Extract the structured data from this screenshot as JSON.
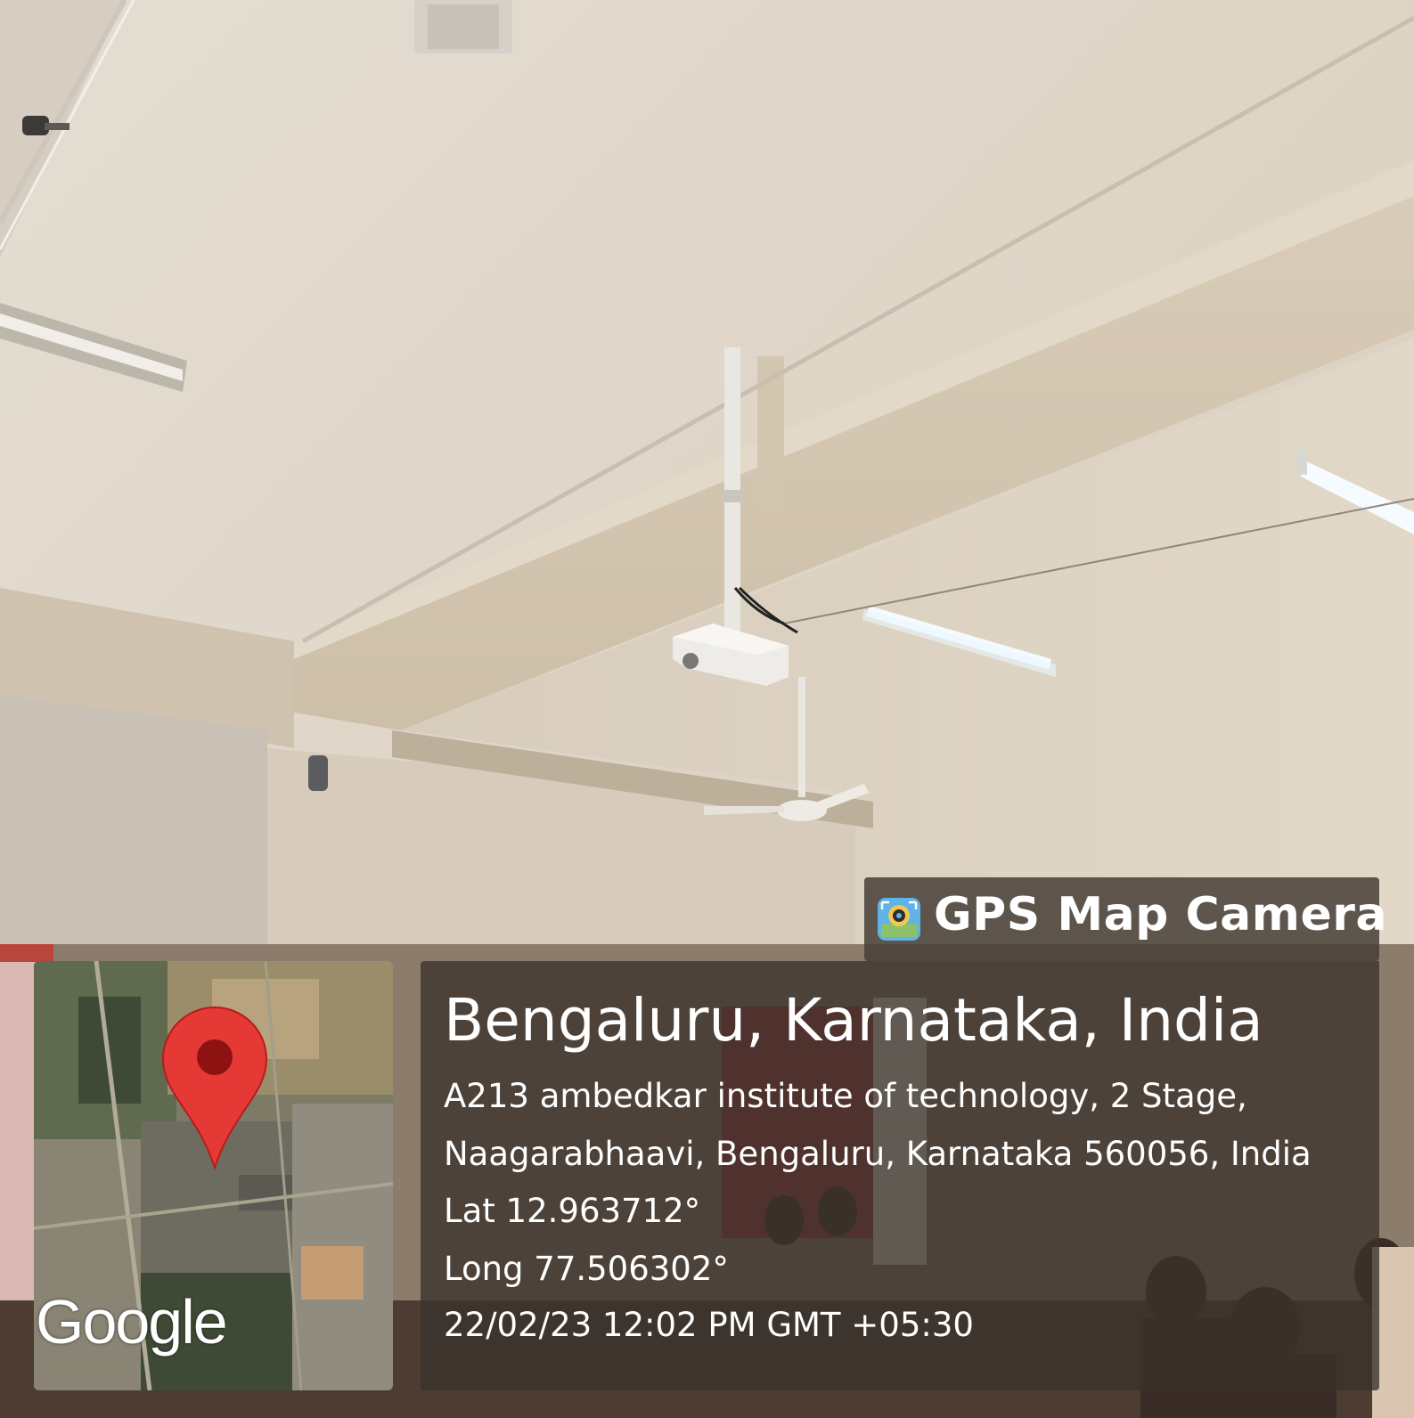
{
  "overlay": {
    "app_title": "GPS Map Camera",
    "app_icon": "gps-map-camera-app-icon",
    "location_title": "Bengaluru, Karnataka, India",
    "address_line1": "A213 ambedkar institute of technology, 2 Stage,",
    "address_line2": "Naagarabhaavi, Bengaluru, Karnataka 560056, India",
    "lat": "Lat 12.963712°",
    "long": "Long 77.506302°",
    "datetime": "22/02/23 12:02 PM GMT +05:30"
  },
  "map": {
    "brand": "Google",
    "marker_icon": "map-pin-icon",
    "marker_color": "#e53935"
  }
}
